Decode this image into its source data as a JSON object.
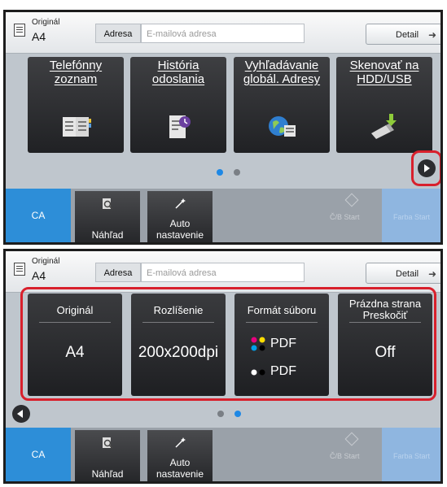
{
  "panels": [
    {
      "header": {
        "original_label": "Originál",
        "original_value": "A4",
        "address_label": "Adresa",
        "address_placeholder": "E-mailová adresa",
        "detail_label": "Detail"
      },
      "tiles": [
        {
          "label": "Telefónny zoznam",
          "icon": "address-book-icon"
        },
        {
          "label": "História odoslania",
          "icon": "send-history-icon"
        },
        {
          "label": "Vyhľadávanie globál. Adresy",
          "icon": "global-search-icon"
        },
        {
          "label": "Skenovať na HDD/USB",
          "icon": "usb-download-icon"
        }
      ],
      "page_dots": {
        "active": 0,
        "count": 2
      },
      "nav_arrow": "next-page-icon",
      "bottom": {
        "ca": "CA",
        "preview": "Náhľad",
        "auto_line1": "Auto",
        "auto_line2": "nastavenie",
        "bw_start": "Č/B Start",
        "color_start": "Farba Start"
      }
    },
    {
      "header": {
        "original_label": "Originál",
        "original_value": "A4",
        "address_label": "Adresa",
        "address_placeholder": "E-mailová adresa",
        "detail_label": "Detail"
      },
      "settings": [
        {
          "label": "Originál",
          "value": "A4"
        },
        {
          "label": "Rozlíšenie",
          "value": "200x200dpi"
        },
        {
          "label": "Formát súboru",
          "value_color": "PDF",
          "value_bw": "PDF"
        },
        {
          "label": "Prázdna strana Preskočiť",
          "value": "Off"
        }
      ],
      "page_dots": {
        "active": 1,
        "count": 2
      },
      "nav_arrow": "previous-page-icon",
      "bottom": {
        "ca": "CA",
        "preview": "Náhľad",
        "auto_line1": "Auto",
        "auto_line2": "nastavenie",
        "bw_start": "Č/B Start",
        "color_start": "Farba Start"
      }
    }
  ],
  "colors": {
    "accent_blue": "#2d8ed8",
    "highlight_red": "#d8202c",
    "tile_dark": "#2a2b2e"
  }
}
